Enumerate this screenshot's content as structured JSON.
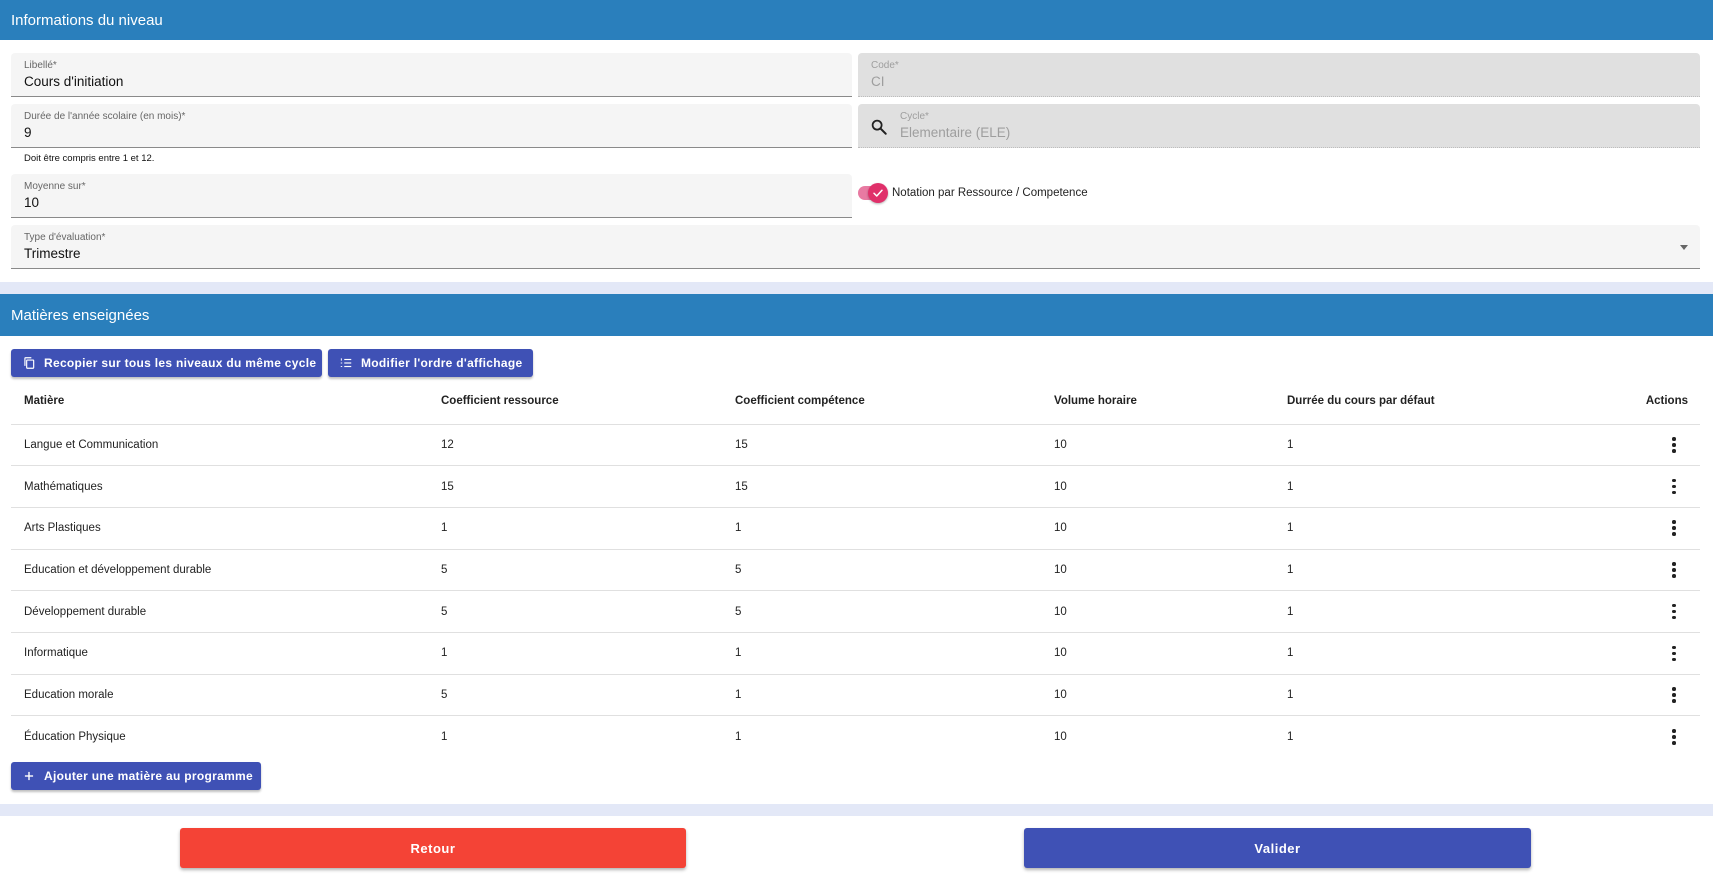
{
  "info": {
    "title": "Informations du niveau",
    "libelle": {
      "label": "Libellé*",
      "value": "Cours d'initiation"
    },
    "code": {
      "label": "Code*",
      "value": "CI"
    },
    "duree": {
      "label": "Durée de l'année scolaire (en mois)*",
      "value": "9",
      "hint": "Doit être compris entre 1 et 12."
    },
    "cycle": {
      "label": "Cycle*",
      "value": "Elementaire (ELE)"
    },
    "moyenne": {
      "label": "Moyenne sur*",
      "value": "10"
    },
    "notation_toggle": {
      "label": "Notation par Ressource / Competence",
      "checked": true
    },
    "type_evaluation": {
      "label": "Type d'évaluation*",
      "value": "Trimestre"
    }
  },
  "matieres": {
    "title": "Matières enseignées",
    "copy_button": "Recopier sur tous les niveaux du même cycle",
    "order_button": "Modifier l'ordre d'affichage",
    "columns": [
      "Matière",
      "Coefficient ressource",
      "Coefficient compétence",
      "Volume horaire",
      "Durrée du cours par défaut",
      "Actions"
    ],
    "rows": [
      [
        "Langue et Communication",
        "12",
        "15",
        "10",
        "1"
      ],
      [
        "Mathématiques",
        "15",
        "15",
        "10",
        "1"
      ],
      [
        "Arts Plastiques",
        "1",
        "1",
        "10",
        "1"
      ],
      [
        "Education et développement durable",
        "5",
        "5",
        "10",
        "1"
      ],
      [
        "Développement durable",
        "5",
        "5",
        "10",
        "1"
      ],
      [
        "Informatique",
        "1",
        "1",
        "10",
        "1"
      ],
      [
        "Education morale",
        "5",
        "1",
        "10",
        "1"
      ],
      [
        "Éducation Physique",
        "1",
        "1",
        "10",
        "1"
      ]
    ],
    "add_button": "Ajouter une matière au programme"
  },
  "footer": {
    "back_button": "Retour",
    "submit_button": "Valider"
  },
  "colors": {
    "header": "#2a7fbc",
    "primary": "#3f51b5",
    "danger": "#f44336",
    "toggle": "#e0306a"
  }
}
